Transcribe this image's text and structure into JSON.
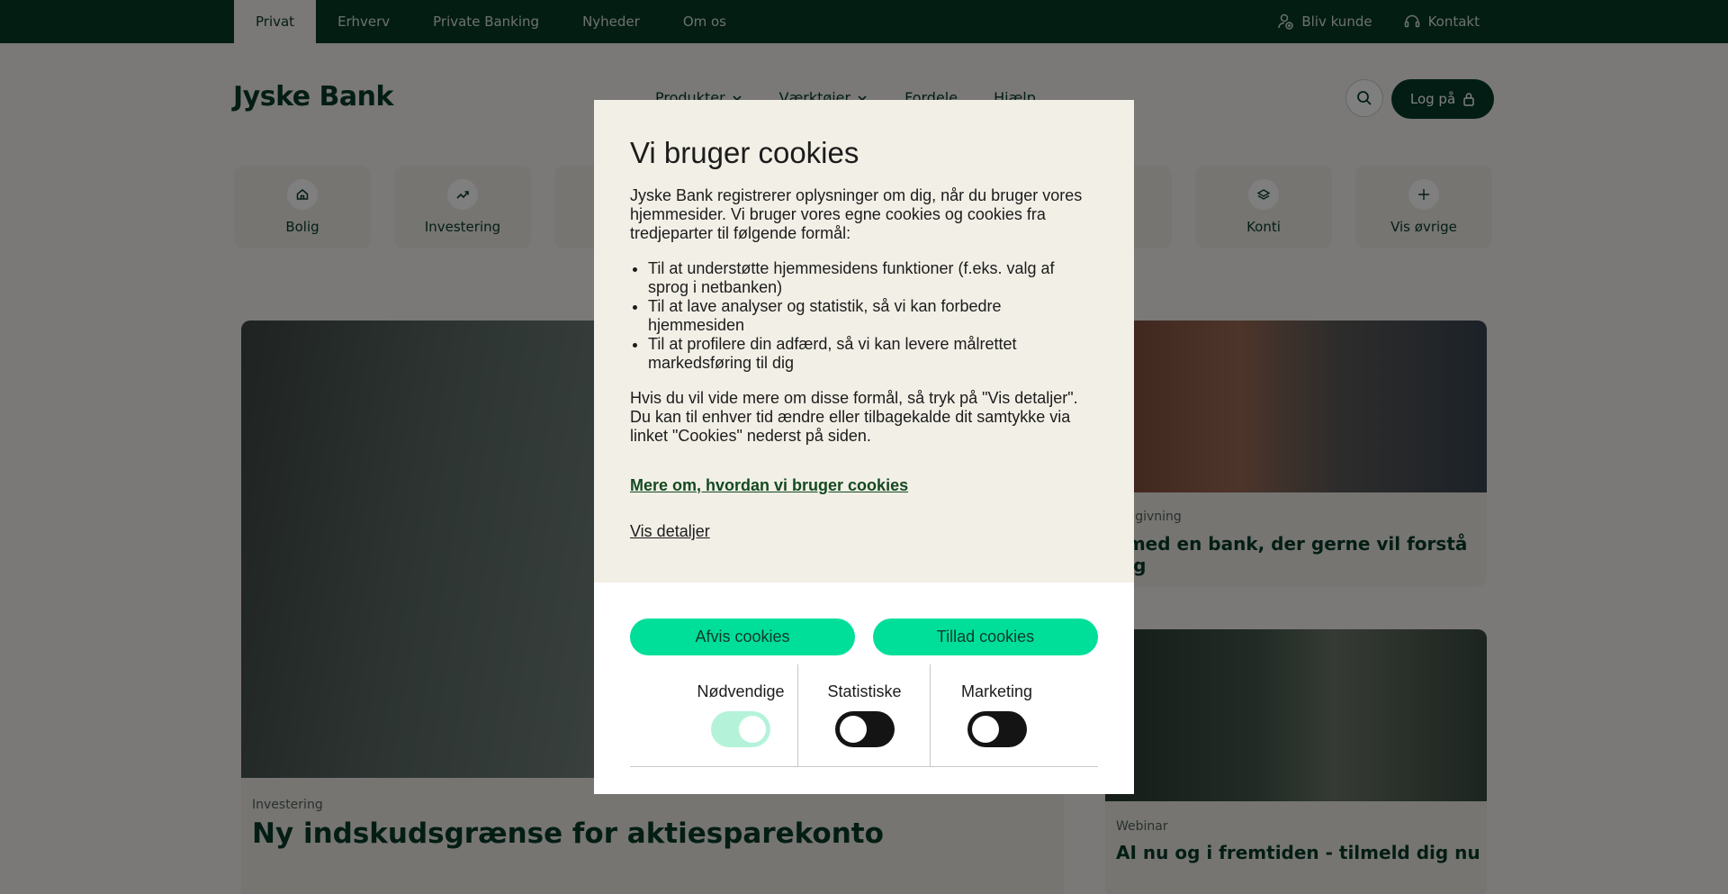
{
  "topbar": {
    "tabs": [
      {
        "label": "Privat",
        "active": true
      },
      {
        "label": "Erhverv"
      },
      {
        "label": "Private Banking"
      },
      {
        "label": "Nyheder"
      },
      {
        "label": "Om os"
      }
    ],
    "become_customer": "Bliv kunde",
    "contact": "Kontakt"
  },
  "header": {
    "logo": "Jyske Bank",
    "nav": [
      "Produkter",
      "Værktøjer",
      "Fordele",
      "Hjælp"
    ],
    "login": "Log på"
  },
  "tiles": [
    {
      "label": "Bolig",
      "icon": "house-icon"
    },
    {
      "label": "Investering",
      "icon": "trend-icon"
    },
    {
      "label": "Konti",
      "icon": "layers-icon"
    },
    {
      "label": "Vis øvrige",
      "icon": "plus-icon"
    }
  ],
  "cards": {
    "main": {
      "category": "Investering",
      "title": "Ny indskudsgrænse for aktiesparekonto"
    },
    "side1": {
      "category": "rådgivning",
      "title": "l med en bank, der gerne vil forstå dig"
    },
    "side2": {
      "category": "Webinar",
      "title": "AI nu og i fremtiden - tilmeld dig nu"
    }
  },
  "cookie": {
    "title": "Vi bruger cookies",
    "intro": "Jyske Bank registrerer oplysninger om dig, når du bruger vores hjemmesider. Vi bruger vores egne cookies og cookies fra tredjeparter til følgende formål:",
    "purposes": [
      "Til at understøtte hjemmesidens funktioner (f.eks. valg af sprog i netbanken)",
      "Til at lave analyser og statistik, så vi kan forbedre hjemmesiden",
      "Til at profilere din adfærd, så vi kan levere målrettet markedsføring til dig"
    ],
    "more_info": "Hvis du vil vide mere om disse formål, så tryk på \"Vis detaljer\". Du kan til enhver tid ændre eller tilbagekalde dit samtykke via linket \"Cookies\" nederst på siden.",
    "more_link": "Mere om, hvordan vi bruger cookies",
    "details_link": "Vis detaljer",
    "reject": "Afvis cookies",
    "allow": "Tillad cookies",
    "toggles": [
      {
        "label": "Nødvendige",
        "on": true
      },
      {
        "label": "Statistiske",
        "on": false
      },
      {
        "label": "Marketing",
        "on": false
      }
    ]
  }
}
